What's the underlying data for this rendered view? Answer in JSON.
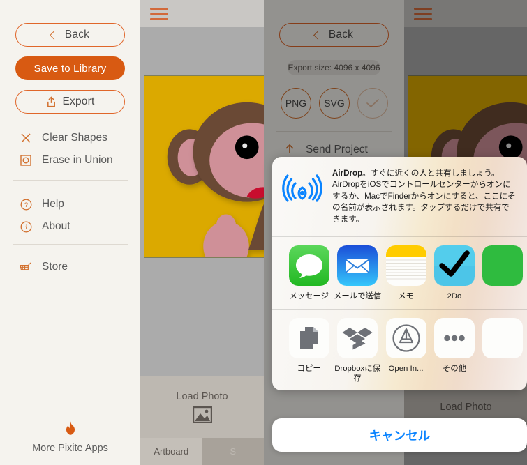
{
  "panel_menu": {
    "back_label": "Back",
    "save_label": "Save to Library",
    "export_label": "Export",
    "items": [
      {
        "label": "Clear Shapes",
        "icon": "close-x-icon"
      },
      {
        "label": "Erase in Union",
        "icon": "erase-union-icon"
      },
      {
        "label": "Help",
        "icon": "question-circle-icon"
      },
      {
        "label": "About",
        "icon": "info-circle-icon"
      },
      {
        "label": "Store",
        "icon": "shopping-cart-icon"
      }
    ],
    "footer_label": "More Pixite Apps",
    "accent": "#d85a12",
    "outline": "#e0662a"
  },
  "panel_canvas": {
    "load_photo_label": "Load Photo",
    "tabs": [
      {
        "label": "Artboard",
        "active": true
      },
      {
        "label": "S",
        "active": false
      }
    ],
    "artwork": {
      "background": "#dba900",
      "fur": "#6b4a35",
      "skin": "#cf9098",
      "eye": "#000000",
      "mouth": "#c8102e"
    }
  },
  "panel_export": {
    "back_label": "Back",
    "export_size_label": "Export size: 4096 x 4096",
    "formats": [
      {
        "label": "PNG",
        "selected": false
      },
      {
        "label": "SVG",
        "selected": false
      },
      {
        "label": "",
        "icon": "check-icon",
        "selected": false
      }
    ],
    "send_project_label": "Send Project"
  },
  "share_sheet": {
    "airdrop": {
      "title": "AirDrop",
      "body": "。すぐに近くの人と共有しましょう。AirDropをiOSでコントロールセンターからオンにするか、MacでFinderからオンにすると、ここにその名前が表示されます。タップするだけで共有できます。"
    },
    "apps_row": [
      {
        "label": "メッセージ",
        "icon": "messages-icon"
      },
      {
        "label": "メールで送信",
        "icon": "mail-icon"
      },
      {
        "label": "メモ",
        "icon": "notes-icon"
      },
      {
        "label": "2Do",
        "icon": "twodo-checkmark-icon"
      }
    ],
    "actions_row": [
      {
        "label": "コピー",
        "icon": "copy-icon"
      },
      {
        "label": "Dropboxに保存",
        "icon": "dropbox-icon"
      },
      {
        "label": "Open In...",
        "icon": "appstore-icon"
      },
      {
        "label": "その他",
        "icon": "ellipsis-icon"
      }
    ],
    "cancel_label": "キャンセル",
    "cancel_color": "#0b84ff"
  }
}
